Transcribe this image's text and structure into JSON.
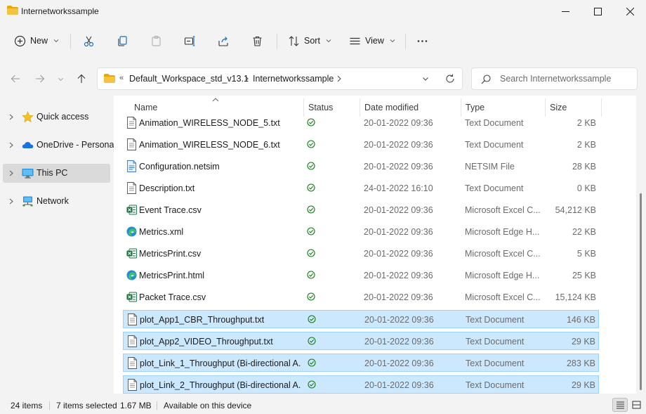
{
  "window": {
    "title": "Internetworkssample",
    "controls": {
      "minimize": "minimize",
      "maximize": "maximize",
      "close": "close"
    }
  },
  "toolbar": {
    "new_label": "New",
    "sort_label": "Sort",
    "view_label": "View"
  },
  "address": {
    "segments": [
      "Default_Workspace_std_v13.1",
      "Internetworkssample"
    ],
    "overflow_glyph": "«"
  },
  "search": {
    "placeholder": "Search Internetworkssample"
  },
  "nav": {
    "items": [
      {
        "label": "Quick access",
        "icon": "star-icon"
      },
      {
        "label": "OneDrive - Personal",
        "icon": "cloud-icon"
      },
      {
        "label": "This PC",
        "icon": "monitor-icon",
        "selected": true
      },
      {
        "label": "Network",
        "icon": "network-icon"
      }
    ]
  },
  "columns": {
    "name": "Name",
    "status": "Status",
    "date": "Date modified",
    "type": "Type",
    "size": "Size"
  },
  "files": [
    {
      "name": "Animation_WIRELESS_NODE_5.txt",
      "date": "20-01-2022 09:36",
      "type": "Text Document",
      "size": "2 KB",
      "icon": "text",
      "selected": false
    },
    {
      "name": "Animation_WIRELESS_NODE_6.txt",
      "date": "20-01-2022 09:36",
      "type": "Text Document",
      "size": "2 KB",
      "icon": "text",
      "selected": false
    },
    {
      "name": "Configuration.netsim",
      "date": "20-01-2022 09:36",
      "type": "NETSIM File",
      "size": "28 KB",
      "icon": "netsim",
      "selected": false
    },
    {
      "name": "Description.txt",
      "date": "24-01-2022 16:10",
      "type": "Text Document",
      "size": "0 KB",
      "icon": "text",
      "selected": false
    },
    {
      "name": "Event Trace.csv",
      "date": "20-01-2022 09:36",
      "type": "Microsoft Excel C...",
      "size": "54,212 KB",
      "icon": "excel",
      "selected": false
    },
    {
      "name": "Metrics.xml",
      "date": "20-01-2022 09:36",
      "type": "Microsoft Edge H...",
      "size": "22 KB",
      "icon": "edge",
      "selected": false
    },
    {
      "name": "MetricsPrint.csv",
      "date": "20-01-2022 09:36",
      "type": "Microsoft Excel C...",
      "size": "5 KB",
      "icon": "excel",
      "selected": false
    },
    {
      "name": "MetricsPrint.html",
      "date": "20-01-2022 09:36",
      "type": "Microsoft Edge H...",
      "size": "25 KB",
      "icon": "edge",
      "selected": false
    },
    {
      "name": "Packet Trace.csv",
      "date": "20-01-2022 09:36",
      "type": "Microsoft Excel C...",
      "size": "15,124 KB",
      "icon": "excel",
      "selected": false
    },
    {
      "name": "plot_App1_CBR_Throughput.txt",
      "date": "20-01-2022 09:36",
      "type": "Text Document",
      "size": "146 KB",
      "icon": "text",
      "selected": true
    },
    {
      "name": "plot_App2_VIDEO_Throughput.txt",
      "date": "20-01-2022 09:36",
      "type": "Text Document",
      "size": "29 KB",
      "icon": "text",
      "selected": true
    },
    {
      "name": "plot_Link_1_Throughput (Bi-directional A...",
      "date": "20-01-2022 09:36",
      "type": "Text Document",
      "size": "283 KB",
      "icon": "text",
      "selected": true
    },
    {
      "name": "plot_Link_2_Throughput (Bi-directional A...",
      "date": "20-01-2022 09:36",
      "type": "Text Document",
      "size": "29 KB",
      "icon": "text",
      "selected": true
    }
  ],
  "status": {
    "item_count": "24 items",
    "selected_count": "7 items selected",
    "selected_size": "1.67 MB",
    "availability": "Available on this device"
  },
  "colors": {
    "selection_fill": "#cce8ff",
    "selection_border": "#99d1ff",
    "folder": "#f5c342",
    "sync_ok": "#107c10"
  }
}
